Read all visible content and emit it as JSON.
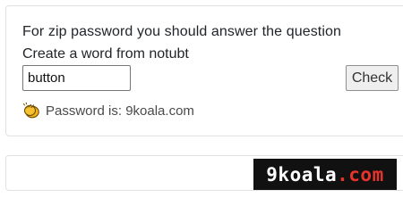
{
  "quiz": {
    "question": "For zip password you should answer the question",
    "prompt": "Create a word from notubt",
    "answer_value": "button",
    "check_label": "Check",
    "password_text": "Password is: 9koala.com"
  },
  "watermark": {
    "part1": "9koala",
    "part2": ".com",
    "colors": {
      "background": "#111111",
      "primary": "#ffffff",
      "accent": "#e8332b"
    }
  },
  "icons": {
    "password_icon": "clapping-hands-icon"
  }
}
